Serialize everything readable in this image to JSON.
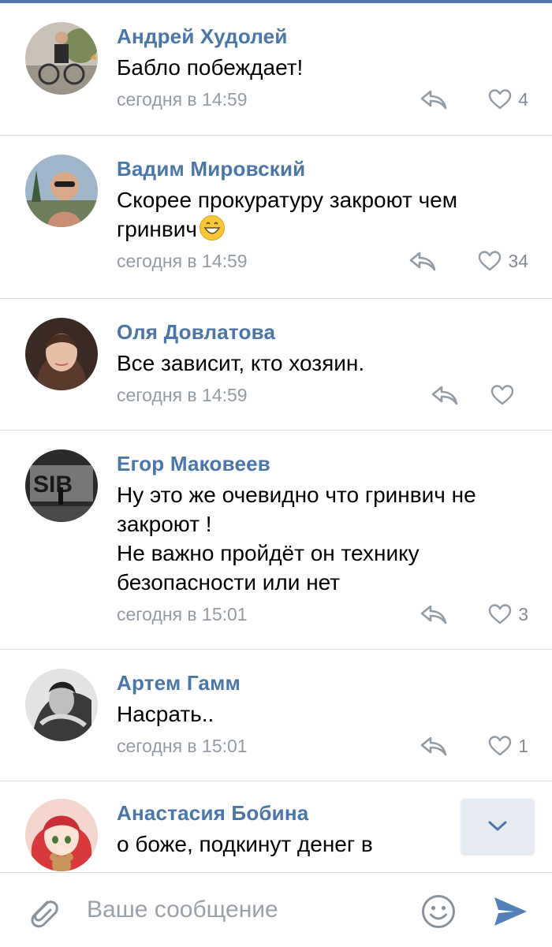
{
  "comments": [
    {
      "author": "Андрей Худолей",
      "text": "Бабло побеждает!",
      "time": "сегодня в 14:59",
      "likes": "4"
    },
    {
      "author": "Вадим Мировский",
      "text": "Скорее прокуратуру закроют чем гринвич",
      "time": "сегодня в 14:59",
      "likes": "34",
      "emoji": "grinning-face-emoji"
    },
    {
      "author": "Оля Довлатова",
      "text": "Все зависит, кто хозяин.",
      "time": "сегодня в 14:59",
      "likes": ""
    },
    {
      "author": "Егор Маковеев",
      "text": "Ну это же очевидно что гринвич не закроют !\nНе важно пройдёт он технику безопасности или нет",
      "time": "сегодня в 15:01",
      "likes": "3"
    },
    {
      "author": "Артем Гамм",
      "text": "Насрать..",
      "time": "сегодня в 15:01",
      "likes": "1"
    },
    {
      "author": "Анастасия Бобина",
      "text": "о боже, подкинут денег в",
      "time": "",
      "likes": ""
    }
  ],
  "composer": {
    "placeholder": "Ваше сообщение",
    "attach_icon": "paperclip-icon",
    "emoji_icon": "smile-icon",
    "send_icon": "send-icon"
  },
  "scroll_down_icon": "chevron-down-icon",
  "colors": {
    "accent": "#4a76a8",
    "meta": "#939ba4",
    "divider": "#dcdfe3",
    "send": "#5181b8"
  }
}
